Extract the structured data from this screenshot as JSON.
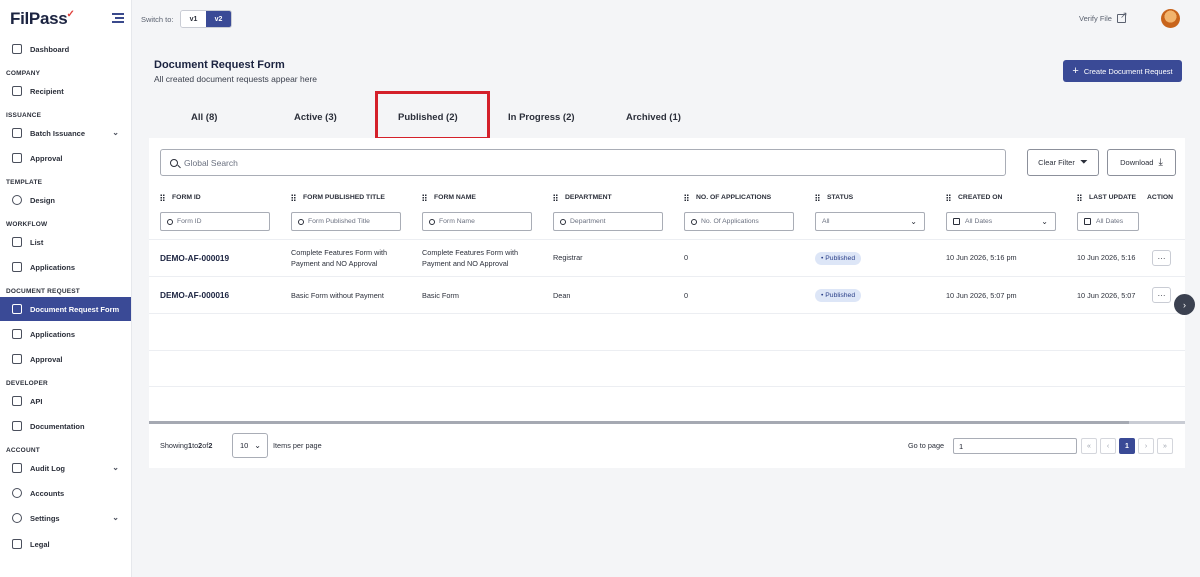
{
  "app": {
    "logo_text": "FilPass"
  },
  "sidebar": {
    "sections": {
      "company": "COMPANY",
      "issuance": "ISSUANCE",
      "template": "TEMPLATE",
      "workflow": "WORKFLOW",
      "document_request": "DOCUMENT REQUEST",
      "developer": "DEVELOPER",
      "account": "ACCOUNT"
    },
    "items": {
      "dashboard": "Dashboard",
      "recipient": "Recipient",
      "batch_issuance": "Batch Issuance",
      "approval": "Approval",
      "design": "Design",
      "list": "List",
      "applications": "Applications",
      "document_request_form": "Document Request Form",
      "dr_applications": "Applications",
      "dr_approval": "Approval",
      "api": "API",
      "documentation": "Documentation",
      "audit_log": "Audit Log",
      "accounts": "Accounts",
      "settings": "Settings",
      "legal": "Legal"
    }
  },
  "topbar": {
    "switch_label": "Switch to:",
    "v1": "v1",
    "v2": "v2",
    "verify_file": "Verify File"
  },
  "header": {
    "title": "Document Request Form",
    "subtitle": "All created document requests appear here",
    "create_button": "Create Document Request"
  },
  "tabs": {
    "all": "All (8)",
    "active": "Active (3)",
    "published": "Published (2)",
    "in_progress": "In Progress (2)",
    "archived": "Archived (1)"
  },
  "toolbar": {
    "search_placeholder": "Global Search",
    "clear_filter": "Clear Filter",
    "download": "Download"
  },
  "table": {
    "headers": {
      "form_id": "FORM ID",
      "published_title": "FORM PUBLISHED TITLE",
      "form_name": "FORM NAME",
      "department": "DEPARTMENT",
      "applications": "NO. OF APPLICATIONS",
      "status": "STATUS",
      "created_on": "CREATED ON",
      "last_updated": "LAST UPDATE",
      "action": "ACTION"
    },
    "filters": {
      "form_id": "Form ID",
      "published_title": "Form Published Title",
      "form_name": "Form Name",
      "department": "Department",
      "applications": "No. Of Applications",
      "status": "All",
      "created_on": "All Dates",
      "last_updated": "All Dates"
    },
    "rows": [
      {
        "form_id": "DEMO-AF-000019",
        "title_line1": "Complete Features Form with",
        "title_line2": "Payment and NO Approval",
        "name_line1": "Complete Features Form with",
        "name_line2": "Payment and NO Approval",
        "department": "Registrar",
        "applications": "0",
        "status": "• Published",
        "created_on": "10 Jun 2026, 5:16 pm",
        "last_updated": "10 Jun 2026, 5:16",
        "action": "···"
      },
      {
        "form_id": "DEMO-AF-000016",
        "title_line1": "Basic Form without Payment",
        "name_line1": "Basic Form",
        "department": "Dean",
        "applications": "0",
        "status": "• Published",
        "created_on": "10 Jun 2026, 5:07 pm",
        "last_updated": "10 Jun 2026, 5:07",
        "action": "···"
      }
    ]
  },
  "pagination": {
    "showing_prefix": "Showing ",
    "range_start": "1",
    "to": " to ",
    "range_end": "2",
    "of": " of ",
    "total": "2",
    "per_page_value": "10",
    "items_per_page": "Items per page",
    "goto_label": "Go to page",
    "goto_value": "1",
    "first": "«",
    "prev": "‹",
    "current": "1",
    "next": "›",
    "last": "»"
  },
  "colors": {
    "primary": "#3a4a96",
    "highlight": "#d4202a",
    "badge_bg": "#dde6f7"
  }
}
